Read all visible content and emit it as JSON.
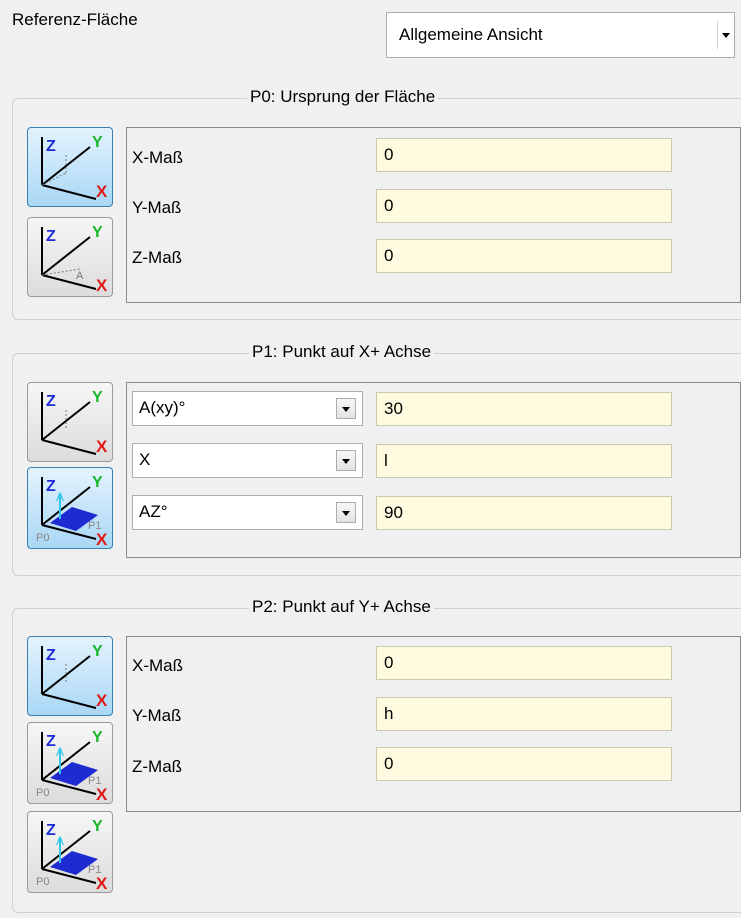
{
  "header": {
    "label": "Referenz-Fläche",
    "view_select": {
      "value": "Allgemeine Ansicht"
    }
  },
  "group_p0": {
    "title": "P0: Ursprung der Fläche",
    "rows": [
      {
        "label": "X-Maß",
        "value": "0"
      },
      {
        "label": "Y-Maß",
        "value": "0"
      },
      {
        "label": "Z-Maß",
        "value": "0"
      }
    ]
  },
  "group_p1": {
    "title": "P1: Punkt auf X+ Achse",
    "rows": [
      {
        "select": "A(xy)°",
        "value": "30"
      },
      {
        "select": "X",
        "value": "l"
      },
      {
        "select": "AZ°",
        "value": "90"
      }
    ]
  },
  "group_p2": {
    "title": "P2: Punkt auf Y+ Achse",
    "rows": [
      {
        "label": "X-Maß",
        "value": "0"
      },
      {
        "label": "Y-Maß",
        "value": "h"
      },
      {
        "label": "Z-Maß",
        "value": "0"
      }
    ]
  },
  "icon_labels": {
    "z": "Z",
    "y": "Y",
    "x": "X",
    "a": "A",
    "p0": "P0",
    "p1": "P1"
  },
  "colors": {
    "axis_z": "#1c2bd6",
    "axis_y": "#17b82a",
    "axis_x": "#e01818",
    "plane": "#1d2bd0",
    "active_button": "#a9d7f5",
    "field_bg": "#fffbe0"
  }
}
